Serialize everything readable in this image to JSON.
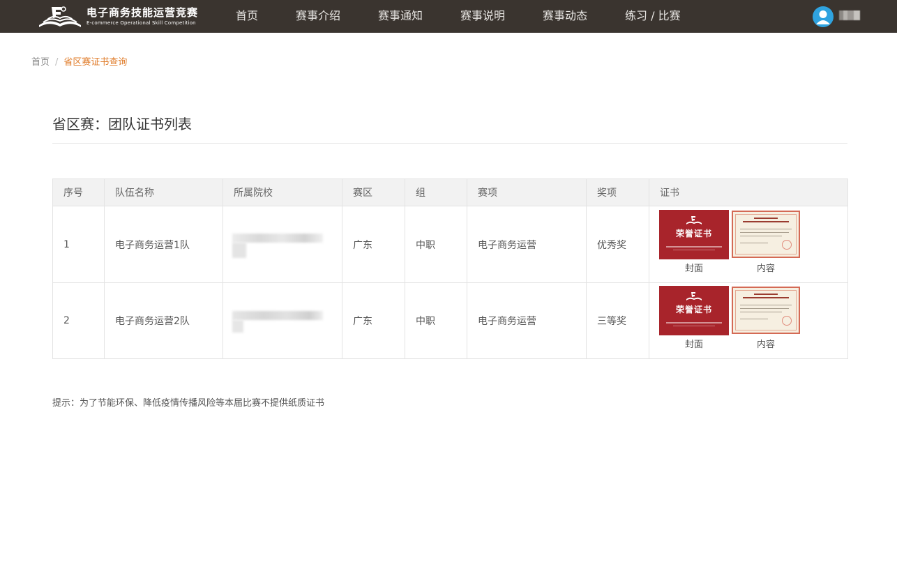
{
  "header": {
    "logo_cn": "电子商务技能运营竞赛",
    "logo_en": "E-commerce Operational Skill Competition",
    "nav": [
      "首页",
      "赛事介绍",
      "赛事通知",
      "赛事说明",
      "赛事动态",
      "练习 / 比赛"
    ],
    "colors": {
      "background": "#3a342f",
      "avatar": "#2fa3e0"
    }
  },
  "breadcrumb": {
    "home": "首页",
    "separator": "/",
    "current": "省区赛证书查询"
  },
  "page_title": "省区赛：团队证书列表",
  "table": {
    "columns": [
      "序号",
      "队伍名称",
      "所属院校",
      "赛区",
      "组",
      "赛项",
      "奖项",
      "证书"
    ],
    "rows": [
      {
        "index": "1",
        "team": "电子商务运营1队",
        "region": "广东",
        "group": "中职",
        "event": "电子商务运营",
        "award": "优秀奖",
        "cover_label": "封面",
        "content_label": "内容"
      },
      {
        "index": "2",
        "team": "电子商务运营2队",
        "region": "广东",
        "group": "中职",
        "event": "电子商务运营",
        "award": "三等奖",
        "cover_label": "封面",
        "content_label": "内容"
      }
    ]
  },
  "certificate": {
    "cover_title": "荣誉证书",
    "cover_color": "#a8242b"
  },
  "tip": "提示：为了节能环保、降低疫情传播风险等本届比赛不提供纸质证书"
}
